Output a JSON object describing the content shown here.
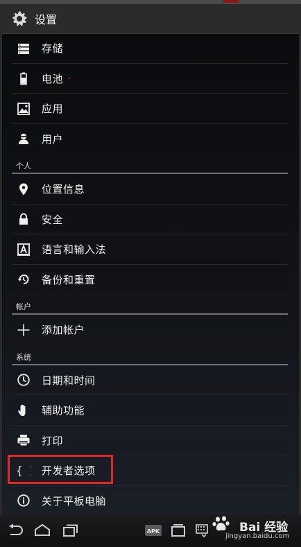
{
  "action_bar": {
    "title": "设置",
    "icon": "gear-icon"
  },
  "sections": [
    {
      "header": null,
      "items": [
        {
          "label": "存储",
          "icon": "storage-icon"
        },
        {
          "label": "电池",
          "icon": "battery-icon"
        },
        {
          "label": "应用",
          "icon": "apps-icon"
        },
        {
          "label": "用户",
          "icon": "user-icon"
        }
      ]
    },
    {
      "header": "个人",
      "items": [
        {
          "label": "位置信息",
          "icon": "location-icon"
        },
        {
          "label": "安全",
          "icon": "lock-icon"
        },
        {
          "label": "语言和输入法",
          "icon": "language-icon"
        },
        {
          "label": "备份和重置",
          "icon": "backup-icon"
        }
      ]
    },
    {
      "header": "帐户",
      "items": [
        {
          "label": "添加帐户",
          "icon": "add-icon"
        }
      ]
    },
    {
      "header": "系统",
      "items": [
        {
          "label": "日期和时间",
          "icon": "clock-icon"
        },
        {
          "label": "辅助功能",
          "icon": "hand-icon"
        },
        {
          "label": "打印",
          "icon": "printer-icon"
        },
        {
          "label": "开发者选项",
          "icon": "braces-icon",
          "highlighted": true
        },
        {
          "label": "关于平板电脑",
          "icon": "info-icon"
        }
      ]
    }
  ],
  "highlight_color": "#e02a2a",
  "navbar": {
    "buttons": [
      "back-icon",
      "home-icon",
      "recent-apps-icon"
    ],
    "apk_label": "APK",
    "watermark_main": "Bai 经验",
    "watermark_sub": "jingyan.baidu.com"
  }
}
